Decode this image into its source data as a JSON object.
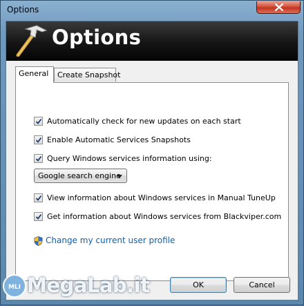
{
  "window": {
    "title": "Options"
  },
  "banner": {
    "title": "Options",
    "icon": "hammer-icon"
  },
  "tabs": [
    {
      "label": "General",
      "active": true
    },
    {
      "label": "Create Snapshot",
      "active": false
    }
  ],
  "options": [
    {
      "label": "Automatically check for new updates on each start",
      "checked": true
    },
    {
      "label": "Enable Automatic Services Snapshots",
      "checked": true
    },
    {
      "label": "Query Windows services information using:",
      "checked": true
    },
    {
      "label": "View information about Windows services in Manual TuneUp",
      "checked": true
    },
    {
      "label": "Get information about Windows services from Blackviper.com",
      "checked": true
    }
  ],
  "query_source": {
    "selected": "Google search engine"
  },
  "profile_link": {
    "label": "Change my current user profile",
    "icon": "uac-shield-icon"
  },
  "buttons": {
    "ok": "OK",
    "cancel": "Cancel"
  },
  "watermark": {
    "text": "MegaLab.it"
  },
  "colors": {
    "link": "#0b5fb5",
    "banner": "#111111",
    "close": "#c2351f",
    "frame": "#5c87ad"
  }
}
